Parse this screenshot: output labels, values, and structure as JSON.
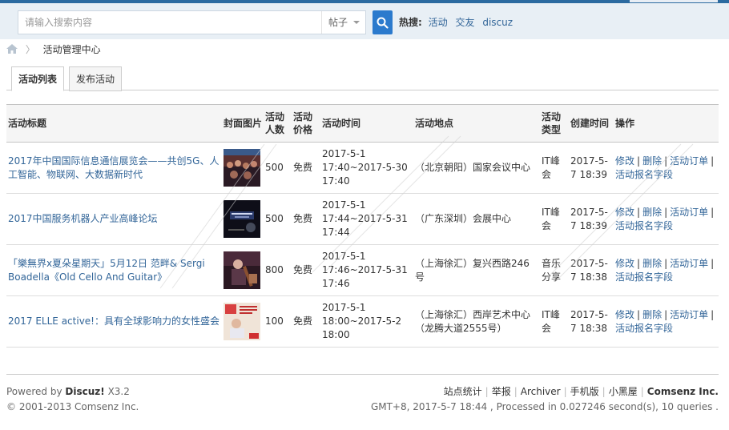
{
  "search": {
    "placeholder": "请输入搜索内容",
    "type_label": "帖子",
    "hot_label": "热搜:",
    "hot_links": [
      "活动",
      "交友",
      "discuz"
    ]
  },
  "breadcrumb": {
    "current": "活动管理中心"
  },
  "tabs": [
    "活动列表",
    "发布活动"
  ],
  "table": {
    "headers": {
      "title": "活动标题",
      "cover": "封面图片",
      "count": "活动人数",
      "price": "活动价格",
      "time": "活动时间",
      "place": "活动地点",
      "type": "活动类型",
      "created": "创建时间",
      "ops": "操作"
    },
    "rows": [
      {
        "title": "2017年中国国际信息通信展览会——共创5G、人工智能、物联网、大数据新时代",
        "count": "500",
        "price": "免费",
        "time": "2017-5-1 17:40~2017-5-30 17:40",
        "place": "（北京朝阳）国家会议中心",
        "type": "IT峰会",
        "created": "2017-5-7 18:39",
        "thumb_color": "#7a3b3b"
      },
      {
        "title": "2017中国服务机器人产业高峰论坛",
        "count": "500",
        "price": "免费",
        "time": "2017-5-1 17:44~2017-5-31 17:44",
        "place": "（广东深圳）会展中心",
        "type": "IT峰会",
        "created": "2017-5-7 18:39",
        "thumb_color": "#1a1a2a"
      },
      {
        "title": "「樂無界x夏朵星期天」5月12日 范畔& Sergi Boadella《Old Cello And Guitar》",
        "count": "800",
        "price": "免费",
        "time": "2017-5-1 17:46~2017-5-31 17:46",
        "place": "（上海徐汇）复兴西路246号",
        "type": "音乐分享",
        "created": "2017-5-7 18:38",
        "thumb_color": "#3a2230"
      },
      {
        "title": "2017 ELLE active!：具有全球影响力的女性盛会",
        "count": "100",
        "price": "免费",
        "time": "2017-5-1 18:00~2017-5-2 18:00",
        "place": "（上海徐汇）西岸艺术中心（龙腾大道2555号）",
        "type": "IT峰会",
        "created": "2017-5-7 18:38",
        "thumb_color": "#e8d8c8"
      }
    ],
    "ops": {
      "edit": "修改",
      "delete": "删除",
      "orders": "活动订单",
      "fields": "活动报名字段"
    }
  },
  "footer": {
    "powered_prefix": "Powered by",
    "brand": "Discuz!",
    "version": "X3.2",
    "copyright": "© 2001-2013 Comsenz Inc.",
    "links": [
      "站点统计",
      "举报",
      "Archiver",
      "手机版",
      "小黑屋"
    ],
    "company": "Comsenz Inc.",
    "stats": "GMT+8, 2017-5-7 18:44 , Processed in 0.027246 second(s), 10 queries ."
  },
  "colors": {
    "accent": "#2b7acd",
    "link": "#336699",
    "topbar": "#2b6aa0"
  }
}
